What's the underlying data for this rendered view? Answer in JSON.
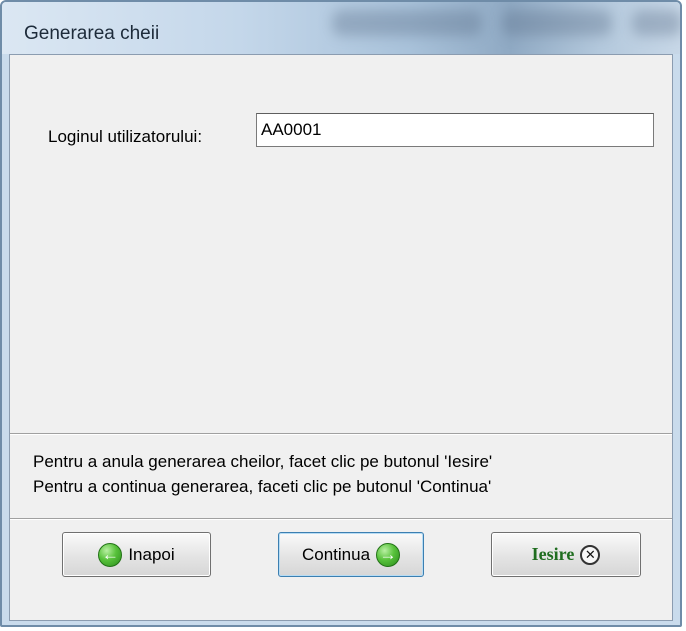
{
  "window": {
    "title": "Generarea cheii"
  },
  "form": {
    "login_label": "Loginul utilizatorului:",
    "login_value": "AA0001"
  },
  "info": {
    "line1": "Pentru a anula generarea cheilor, facet clic pe butonul 'Iesire'",
    "line2": "Pentru a continua generarea, faceti clic pe butonul 'Continua'"
  },
  "buttons": {
    "back_label": "Inapoi",
    "continue_label": "Continua",
    "exit_label": "Iesire"
  },
  "icons": {
    "back": "arrow-left-circle-icon",
    "continue": "arrow-right-circle-icon",
    "exit": "close-circle-icon"
  },
  "colors": {
    "accent_green": "#3fae28",
    "exit_text": "#1f6d1f",
    "dialog_bg": "#f0f0f0"
  }
}
